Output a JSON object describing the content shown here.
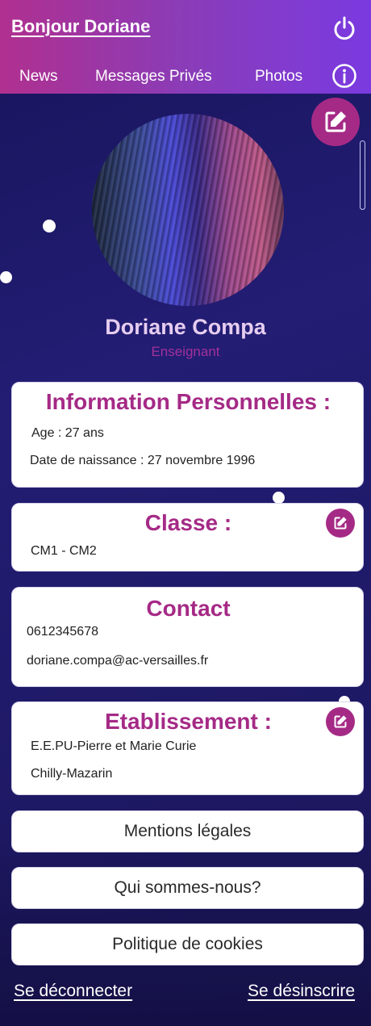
{
  "header": {
    "greeting": "Bonjour Doriane",
    "power_icon": "power-icon",
    "info_icon": "info-icon",
    "nav": [
      "News",
      "Messages Privés",
      "Photos"
    ]
  },
  "profile": {
    "name": "Doriane Compa",
    "role": "Enseignant"
  },
  "personal": {
    "title": "Information Personnelles :",
    "age": "Age : 27 ans",
    "birth": "Date de naissance : 27 novembre 1996"
  },
  "classe": {
    "title": "Classe :",
    "value": "CM1 - CM2"
  },
  "contact": {
    "title": "Contact",
    "phone": "0612345678",
    "email": "doriane.compa@ac-versailles.fr"
  },
  "school": {
    "title": "Etablissement :",
    "name": "E.E.PU-Pierre et Marie Curie",
    "city": "Chilly-Mazarin"
  },
  "buttons": {
    "legal": "Mentions légales",
    "about": "Qui sommes-nous?",
    "cookies": "Politique de cookies"
  },
  "footer": {
    "logout": "Se déconnecter",
    "unsubscribe": "Se désinscrire"
  },
  "colors": {
    "accent": "#a52a86",
    "header_start": "#b0308f",
    "header_end": "#7a3ae0",
    "background": "#1c1a52"
  }
}
